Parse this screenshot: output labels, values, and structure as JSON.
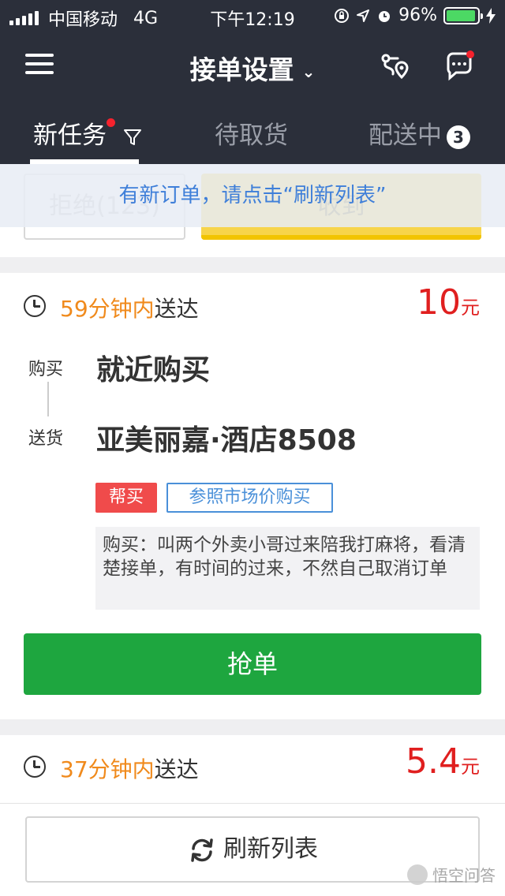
{
  "status_bar": {
    "carrier": "中国移动",
    "network": "4G",
    "time": "下午12:19",
    "battery_text": "96%",
    "battery_level": 0.96
  },
  "nav": {
    "title": "接单设置",
    "menu_icon": "hamburger-menu-icon",
    "route_icon": "route-map-icon",
    "message_icon": "chat-bubble-icon"
  },
  "tabs": [
    {
      "label": "新任务",
      "active": true
    },
    {
      "label": "待取货",
      "active": false
    },
    {
      "label": "配送中",
      "count": "3",
      "active": false
    }
  ],
  "toast": "有新订单，请点击“刷新列表”",
  "prev_card": {
    "reject_label": "拒绝(123)",
    "accept_label": "收到"
  },
  "order1": {
    "deliver_minutes": "59分钟内",
    "deliver_suffix": "送达",
    "price": "10",
    "price_unit": "元",
    "buy_label": "购买",
    "buy_value": "就近购买",
    "send_label": "送货",
    "send_value": "亚美丽嘉·酒店8508",
    "tag_help": "帮买",
    "tag_market": "参照市场价购买",
    "note": "购买：叫两个外卖小哥过来陪我打麻将，看清楚接单，有时间的过来，不然自己取消订单",
    "grab_label": "抢单"
  },
  "order2": {
    "deliver_minutes": "37分钟内",
    "deliver_suffix": "送达",
    "price": "5.4",
    "price_unit": "元"
  },
  "refresh": {
    "label": "刷新列表"
  },
  "watermark": "悟空问答",
  "colors": {
    "header_bg": "#2b2f3a",
    "orange": "#f08a1c",
    "price_red": "#e01f1f",
    "grab_green": "#1ea63f",
    "accept_yellow": "#f7d44a",
    "link_blue": "#4a90d9"
  }
}
